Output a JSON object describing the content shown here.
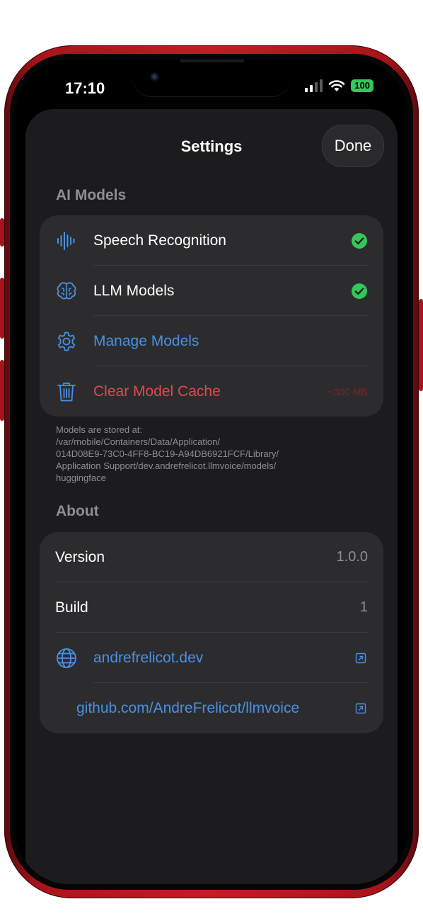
{
  "status_bar": {
    "time": "17:10",
    "battery": "100"
  },
  "nav": {
    "title": "Settings",
    "done_label": "Done"
  },
  "ai_models": {
    "header": "AI Models",
    "rows": [
      {
        "label": "Speech Recognition",
        "icon": "waveform-icon",
        "status": "check"
      },
      {
        "label": "LLM Models",
        "icon": "brain-icon",
        "status": "check"
      },
      {
        "label": "Manage Models",
        "icon": "gear-icon"
      },
      {
        "label": "Clear Model Cache",
        "icon": "trash-icon",
        "trailing": "~300 MB"
      }
    ],
    "footnote_lines": [
      "Models are stored at:",
      "/var/mobile/Containers/Data/Application/",
      "014D08E9-73C0-4FF8-BC19-A94DB6921FCF/Library/",
      "Application Support/dev.andrefrelicot.llmvoice/models/",
      "huggingface"
    ]
  },
  "about": {
    "header": "About",
    "version_label": "Version",
    "version_value": "1.0.0",
    "build_label": "Build",
    "build_value": "1",
    "website": "andrefrelicot.dev",
    "github": "github.com/AndreFrelicot/llmvoice"
  },
  "colors": {
    "accent": "#4a90e2",
    "danger": "#e0494c",
    "success": "#34c759",
    "frame": "#c41d24"
  }
}
